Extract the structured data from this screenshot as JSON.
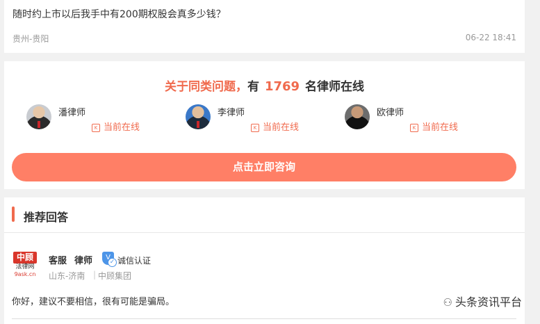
{
  "question": {
    "text": "随时约上市以后我手中有200期权股会真多少钱？",
    "location": "贵州-贵阳",
    "time": "06-22 18:41"
  },
  "lawyers_section": {
    "header_prefix": "关于同类问题，",
    "header_have": "有",
    "online_count": "1769",
    "header_suffix": "名律师在线",
    "lawyers": [
      {
        "name": "潘律师",
        "status": "当前在线"
      },
      {
        "name": "李律师",
        "status": "当前在线"
      },
      {
        "name": "欧律师",
        "status": "当前在线"
      }
    ],
    "consult_button": "点击立即咨询"
  },
  "recommended": {
    "title": "推荐回答",
    "logo": {
      "line1": "中顾",
      "line2": "法律网",
      "line3": "9ask.cn"
    },
    "name": "客服",
    "role": "律师",
    "badge": "诚信认证",
    "location": "山东-济南",
    "separator": "|",
    "org": "中顾集团",
    "answer": "你好，建议不要相信，很有可能是骗局。"
  },
  "watermark": "头条资讯平台"
}
